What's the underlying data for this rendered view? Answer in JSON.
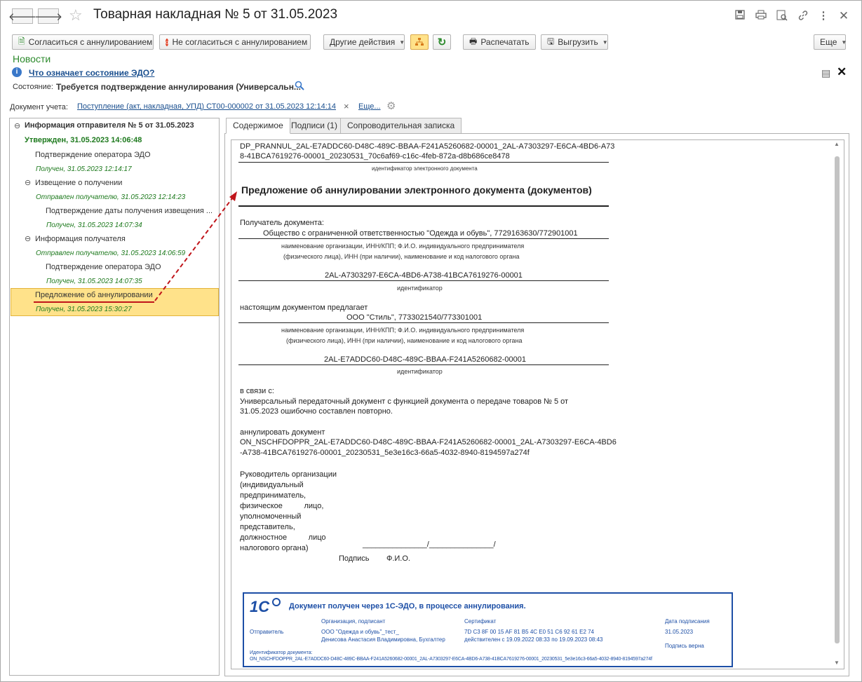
{
  "window": {
    "title": "Товарная накладная № 5 от 31.05.2023"
  },
  "toolbar": {
    "agree": "Согласиться с аннулированием",
    "disagree": "Не согласиться с аннулированием",
    "other": "Другие действия",
    "print": "Распечатать",
    "export": "Выгрузить",
    "more": "Еще"
  },
  "news": "Новости",
  "info_link": "Что означает состояние ЭДО?",
  "state": {
    "label": "Состояние:",
    "value": "Требуется подтверждение аннулирования (Универсальн..."
  },
  "account_doc": {
    "label": "Документ учета:",
    "link": "Поступление (акт, накладная, УПД) СТ00-000002 от 31.05.2023 12:14:14",
    "more": "Еще..."
  },
  "tree": {
    "root": "Информация отправителя № 5 от 31.05.2023",
    "approved": "Утвержден, 31.05.2023 14:06:48",
    "items": [
      {
        "label": "Подтверждение оператора ЭДО",
        "ts": "Получен, 31.05.2023 12:14:17"
      },
      {
        "label": "Извещение о получении",
        "ts": "Отправлен получателю, 31.05.2023 12:14:23"
      },
      {
        "label": "Подтверждение даты получения извещения ...",
        "ts": "Получен, 31.05.2023 14:07:34"
      },
      {
        "label": "Информация получателя",
        "ts": "Отправлен получателю, 31.05.2023 14:06:59"
      },
      {
        "label": "Подтверждение оператора ЭДО",
        "ts": "Получен, 31.05.2023 14:07:35"
      },
      {
        "label": "Предложение об аннулировании",
        "ts": "Получен, 31.05.2023 15:30:27"
      }
    ]
  },
  "tabs": [
    "Содержимое",
    "Подписи (1)",
    "Сопроводительная записка"
  ],
  "doc": {
    "file_id_1": "DP_PRANNUL_2AL-E7ADDC60-D48C-489C-BBAA-F241A5260682-00001_2AL-A7303297-E6CA-4BD6-A73",
    "file_id_2": "8-41BCA7619276-00001_20230531_70c6af69-c16c-4feb-872a-d8b686ce8478",
    "file_id_caption": "идентификатор электронного документа",
    "heading": "Предложение об аннулировании электронного документа (документов)",
    "recipient_label": "Получатель документа:",
    "recipient_value": "Общество с ограниченной ответственностью \"Одежда и обувь\", 7729163630/772901001",
    "org_caption_1": "наименование организации, ИНН/КПП; Ф.И.О. индивидуального предпринимателя",
    "org_caption_2": "(физического лица), ИНН (при наличии), наименование и код налогового органа",
    "recipient_id": "2AL-A7303297-E6CA-4BD6-A738-41BCA7619276-00001",
    "id_caption": "идентификатор",
    "proposer_label": "настоящим документом предлагает",
    "proposer_value": "ООО \"Стиль\", 7733021540/773301001",
    "proposer_id": "2AL-E7ADDC60-D48C-489C-BBAA-F241A5260682-00001",
    "reason_label": "в связи с:",
    "reason_1": "Универсальный передаточный документ с функцией документа о передаче товаров № 5 от",
    "reason_2": "31.05.2023 ошибочно составлен повторно.",
    "annul_label": "аннулировать документ",
    "annul_1": "ON_NSCHFDOPPR_2AL-E7ADDC60-D48C-489C-BBAA-F241A5260682-00001_2AL-A7303297-E6CA-4BD6",
    "annul_2": "-A738-41BCA7619276-00001_20230531_5e3e16c3-66a5-4032-8940-8194597a274f",
    "head_lines": [
      "Руководитель  организации",
      "(индивидуальный",
      "предприниматель,",
      "физическое          лицо,",
      "уполномоченный",
      "представитель,",
      "должностное          лицо",
      "налогового органа)"
    ],
    "sign_line": "_______________/_______________/",
    "sign_caption": "Подпись        Ф.И.О."
  },
  "stamp": {
    "logo": "1С",
    "title": "Документ получен через 1С-ЭДО, в процессе аннулирования.",
    "col_org": "Организация, подписант",
    "col_cert": "Сертификат",
    "col_date": "Дата подписания",
    "sender_label": "Отправитель",
    "org": "ООО \"Одежда и обувь\"_тест_",
    "person": "Денисова Анастасия Владимировна, Бухгалтер",
    "cert": "7D C3 8F 00 15 AF 81 B5 4C E0 51 C6 92 61 E2 74",
    "valid": "действителен с 19.09.2022 08:33 по 19.09.2023 08:43",
    "date": "31.05.2023",
    "sig_ok": "Подпись верна",
    "docid_label": "Идентификатор документа:",
    "docid": "ON_NSCHFDOPPR_2AL-E7ADDC60-D48C-489C-BBAA-F241A5260682-00001_2AL-A7303297-E6CA-4BD6-A738-41BCA7619276-00001_20230531_5e3e16c3-66a5-4032-8940-8194597a274f"
  },
  "colors": {
    "accent_green": "#1e7a1e",
    "link_blue": "#1a4f8f",
    "selected": "#ffe28a",
    "annotation_red": "#c0141a",
    "stamp_blue": "#1d4fa6"
  }
}
